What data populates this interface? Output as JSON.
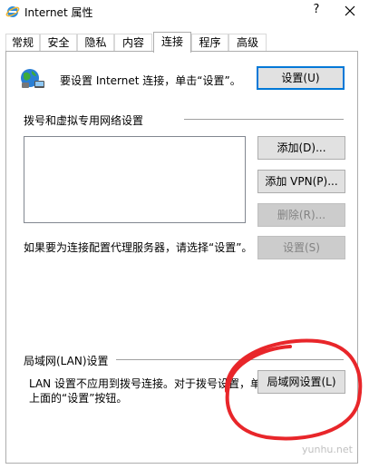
{
  "window": {
    "title": "Internet 属性",
    "help_label": "?",
    "close_label": "X"
  },
  "tabs": [
    {
      "label": "常规"
    },
    {
      "label": "安全"
    },
    {
      "label": "隐私"
    },
    {
      "label": "内容"
    },
    {
      "label": "连接",
      "active": true
    },
    {
      "label": "程序"
    },
    {
      "label": "高级"
    }
  ],
  "setup": {
    "text": "要设置 Internet 连接，单击“设置”。",
    "button": "设置(U)"
  },
  "dialup": {
    "heading": "拨号和虚拟专用网络设置",
    "add_button": "添加(D)...",
    "add_vpn_button": "添加 VPN(P)...",
    "delete_button": "删除(R)...",
    "proxy_text": "如果要为连接配置代理服务器，请选择“设置”。",
    "settings_button": "设置(S)"
  },
  "lan": {
    "heading": "局域网(LAN)设置",
    "line1": "LAN 设置不应用到拨号连接。对于拨号设置，单",
    "line2": "上面的“设置”按钮。",
    "button": "局域网设置(L)"
  },
  "annotation": {
    "color": "#e8262a"
  },
  "watermark": "yunhu.net"
}
